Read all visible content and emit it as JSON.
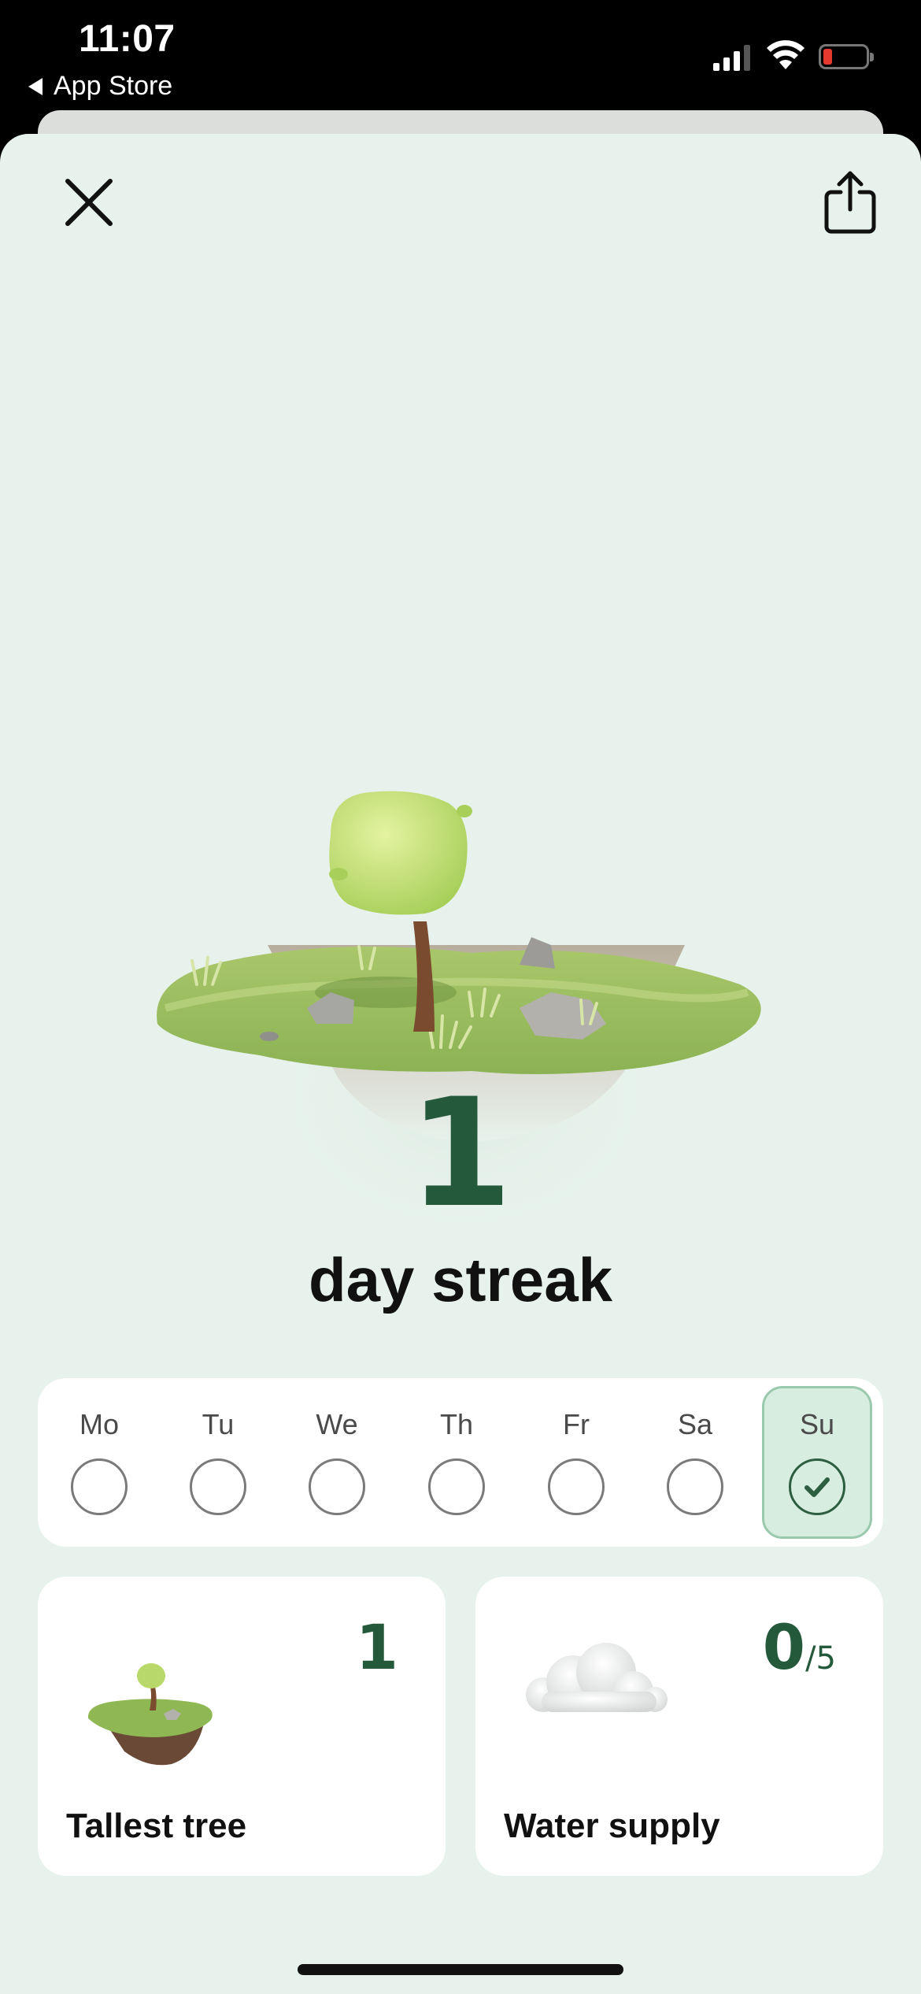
{
  "status_bar": {
    "time": "11:07",
    "back_label": "App Store",
    "battery_color": "#e5392f"
  },
  "header": {
    "close_icon": "close-icon",
    "share_icon": "share-icon"
  },
  "streak": {
    "count": "1",
    "label": "day streak"
  },
  "week": {
    "days": [
      {
        "label": "Mo",
        "done": false
      },
      {
        "label": "Tu",
        "done": false
      },
      {
        "label": "We",
        "done": false
      },
      {
        "label": "Th",
        "done": false
      },
      {
        "label": "Fr",
        "done": false
      },
      {
        "label": "Sa",
        "done": false
      },
      {
        "label": "Su",
        "done": true
      }
    ]
  },
  "stats": {
    "tallest_tree": {
      "value": "1",
      "label": "Tallest tree"
    },
    "water_supply": {
      "value": "0",
      "denominator": "/5",
      "label": "Water supply"
    }
  },
  "colors": {
    "accent": "#245a3b",
    "background": "#e7f2ec",
    "active_day": "#d7ede0"
  }
}
